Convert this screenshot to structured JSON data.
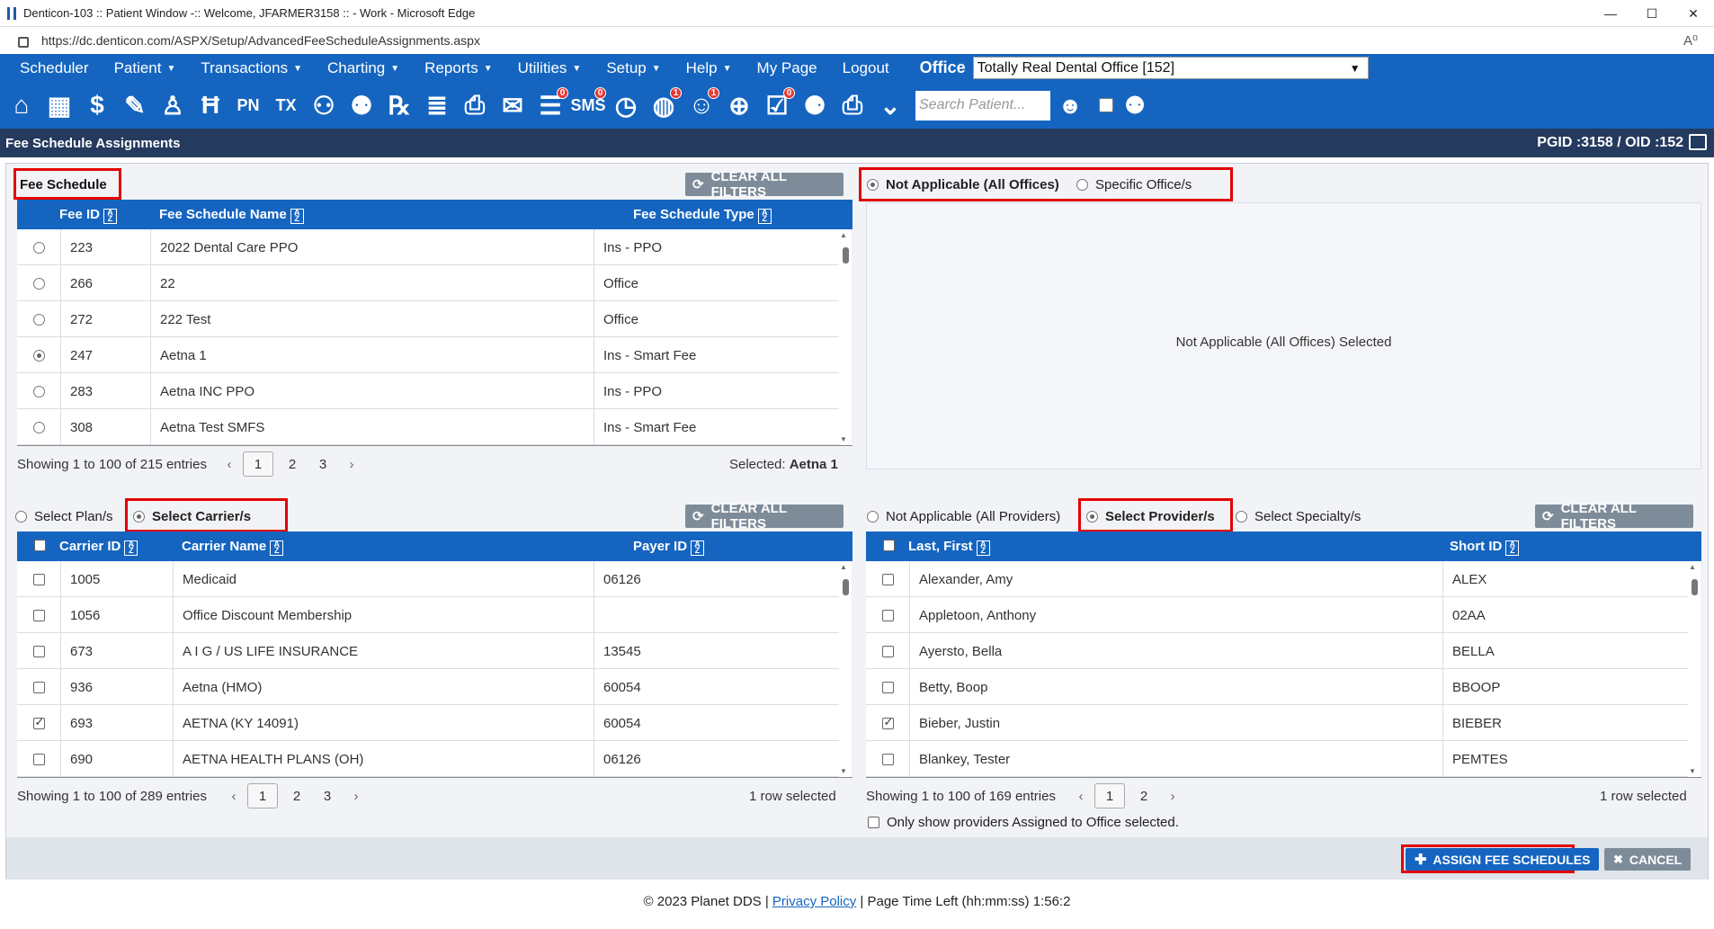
{
  "window": {
    "title": "Denticon-103 :: Patient Window -:: Welcome, JFARMER3158 :: - Work - Microsoft Edge",
    "minimize": "—",
    "maximize": "☐",
    "close": "✕"
  },
  "browser": {
    "url": "https://dc.denticon.com/ASPX/Setup/AdvancedFeeScheduleAssignments.aspx",
    "reader_icon": "A⁰"
  },
  "menu": {
    "items": [
      {
        "label": "Scheduler",
        "caret": false
      },
      {
        "label": "Patient",
        "caret": true
      },
      {
        "label": "Transactions",
        "caret": true
      },
      {
        "label": "Charting",
        "caret": true
      },
      {
        "label": "Reports",
        "caret": true
      },
      {
        "label": "Utilities",
        "caret": true
      },
      {
        "label": "Setup",
        "caret": true
      },
      {
        "label": "Help",
        "caret": true
      },
      {
        "label": "My Page",
        "caret": false
      },
      {
        "label": "Logout",
        "caret": false
      }
    ],
    "office_label": "Office",
    "office_value": "Totally Real Dental Office [152]"
  },
  "toolbar": {
    "icons": [
      {
        "name": "home-icon",
        "glyph": "⌂",
        "badge": ""
      },
      {
        "name": "calendar-icon",
        "glyph": "▦",
        "badge": ""
      },
      {
        "name": "dollar-icon",
        "glyph": "$",
        "badge": ""
      },
      {
        "name": "ledger-edit-icon",
        "glyph": "✎",
        "badge": ""
      },
      {
        "name": "tooth-icon",
        "glyph": "♙",
        "badge": ""
      },
      {
        "name": "tooth-chart-icon",
        "glyph": "Ħ",
        "badge": ""
      },
      {
        "name": "progress-notes-icon",
        "glyph": "PN",
        "badge": ""
      },
      {
        "name": "treatment-icon",
        "glyph": "TX",
        "badge": ""
      },
      {
        "name": "add-patient-icon",
        "glyph": "⚇",
        "badge": ""
      },
      {
        "name": "add-family-icon",
        "glyph": "⚉",
        "badge": ""
      },
      {
        "name": "prescription-icon",
        "glyph": "℞",
        "badge": ""
      },
      {
        "name": "notes-icon",
        "glyph": "≣",
        "badge": ""
      },
      {
        "name": "scanner-icon",
        "glyph": "⎙",
        "badge": ""
      },
      {
        "name": "mail-icon",
        "glyph": "✉",
        "badge": ""
      },
      {
        "name": "messages-icon",
        "glyph": "☰",
        "badge": "0"
      },
      {
        "name": "sms-icon",
        "glyph": "SMS",
        "badge": "0"
      },
      {
        "name": "clock-icon",
        "glyph": "◷",
        "badge": ""
      },
      {
        "name": "global-alert-icon",
        "glyph": "◍",
        "badge": "1"
      },
      {
        "name": "support-icon",
        "glyph": "☺",
        "badge": "1"
      },
      {
        "name": "web-icon",
        "glyph": "⊕",
        "badge": ""
      },
      {
        "name": "task-list-icon",
        "glyph": "☑",
        "badge": "0"
      },
      {
        "name": "people-icon",
        "glyph": "⚈",
        "badge": ""
      },
      {
        "name": "print-icon",
        "glyph": "⎙",
        "badge": ""
      },
      {
        "name": "expand-down-icon",
        "glyph": "⌄",
        "badge": ""
      }
    ],
    "search_placeholder": "Search Patient..."
  },
  "header": {
    "title": "Fee Schedule Assignments",
    "ids": "PGID :3158  /  OID :152"
  },
  "fee_schedule": {
    "section_label": "Fee Schedule",
    "clear_filters": "CLEAR ALL FILTERS",
    "columns": [
      "Fee ID",
      "Fee Schedule Name",
      "Fee Schedule Type"
    ],
    "rows": [
      {
        "selected": false,
        "id": "223",
        "name": "2022 Dental Care PPO",
        "type": "Ins - PPO"
      },
      {
        "selected": false,
        "id": "266",
        "name": "22",
        "type": "Office"
      },
      {
        "selected": false,
        "id": "272",
        "name": "222 Test",
        "type": "Office"
      },
      {
        "selected": true,
        "id": "247",
        "name": "Aetna 1",
        "type": "Ins - Smart Fee"
      },
      {
        "selected": false,
        "id": "283",
        "name": "Aetna INC PPO",
        "type": "Ins - PPO"
      },
      {
        "selected": false,
        "id": "308",
        "name": "Aetna Test SMFS",
        "type": "Ins - Smart Fee"
      }
    ],
    "showing": "Showing 1 to 100 of 215 entries",
    "pages": [
      "1",
      "2",
      "3"
    ],
    "selected_label": "Selected:",
    "selected_value": "Aetna 1"
  },
  "office": {
    "option_all": "Not Applicable (All Offices)",
    "option_specific": "Specific Office/s",
    "message": "Not Applicable (All Offices) Selected"
  },
  "carriers": {
    "option_plans": "Select Plan/s",
    "option_carriers": "Select Carrier/s",
    "clear_filters": "CLEAR ALL FILTERS",
    "columns": [
      "Carrier ID",
      "Carrier Name",
      "Payer ID"
    ],
    "rows": [
      {
        "checked": false,
        "id": "1005",
        "name": "Medicaid",
        "payer": "06126"
      },
      {
        "checked": false,
        "id": "1056",
        "name": "Office Discount Membership",
        "payer": ""
      },
      {
        "checked": false,
        "id": "673",
        "name": "A I G / US LIFE INSURANCE",
        "payer": "13545"
      },
      {
        "checked": false,
        "id": "936",
        "name": "Aetna (HMO)",
        "payer": "60054"
      },
      {
        "checked": true,
        "id": "693",
        "name": "AETNA (KY 14091)",
        "payer": "60054"
      },
      {
        "checked": false,
        "id": "690",
        "name": "AETNA HEALTH PLANS (OH)",
        "payer": "06126"
      }
    ],
    "showing": "Showing 1 to 100 of 289 entries",
    "pages": [
      "1",
      "2",
      "3"
    ],
    "row_selected": "1 row selected"
  },
  "providers": {
    "option_all": "Not Applicable (All Providers)",
    "option_select": "Select Provider/s",
    "option_specialty": "Select Specialty/s",
    "clear_filters": "CLEAR ALL FILTERS",
    "columns": [
      "Last, First",
      "Short ID"
    ],
    "rows": [
      {
        "checked": false,
        "name": "Alexander, Amy",
        "short": "ALEX"
      },
      {
        "checked": false,
        "name": "Appletoon, Anthony",
        "short": "02AA"
      },
      {
        "checked": false,
        "name": "Ayersto, Bella",
        "short": "BELLA"
      },
      {
        "checked": false,
        "name": "Betty, Boop",
        "short": "BBOOP"
      },
      {
        "checked": true,
        "name": "Bieber, Justin",
        "short": "BIEBER"
      },
      {
        "checked": false,
        "name": "Blankey, Tester",
        "short": "PEMTES"
      }
    ],
    "showing": "Showing 1 to 100 of 169 entries",
    "pages": [
      "1",
      "2"
    ],
    "row_selected": "1 row selected",
    "only_assigned": "Only show providers Assigned to Office selected."
  },
  "actions": {
    "assign": "ASSIGN FEE SCHEDULES",
    "cancel": "CANCEL"
  },
  "footer": {
    "copyright": "© 2023 Planet DDS | ",
    "privacy": "Privacy Policy",
    "time_left": " |  Page Time Left (hh:mm:ss) 1:56:2"
  },
  "colors": {
    "brand_blue": "#1565c0",
    "header_navy": "#243a5e",
    "highlight_red": "#e30000",
    "assign_blue": "#1565c0",
    "clear_gray": "#7e8c99"
  }
}
